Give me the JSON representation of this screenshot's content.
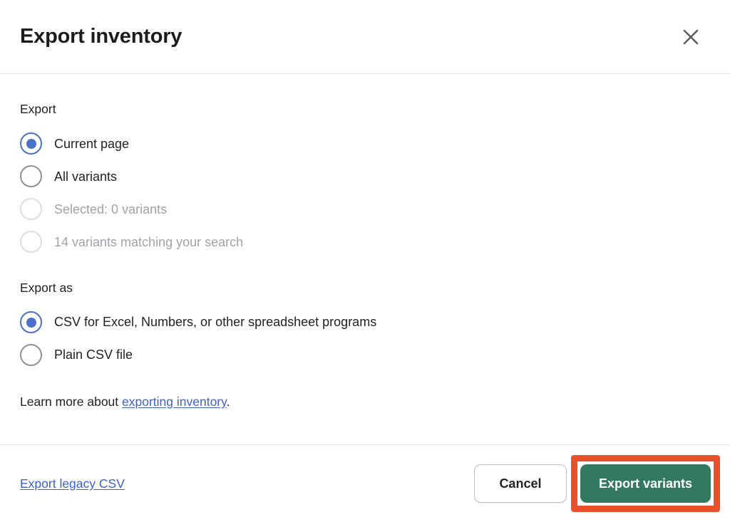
{
  "modal": {
    "title": "Export inventory",
    "close_icon": "close-icon"
  },
  "export_section": {
    "label": "Export",
    "options": [
      {
        "label": "Current page",
        "selected": true,
        "disabled": false
      },
      {
        "label": "All variants",
        "selected": false,
        "disabled": false
      },
      {
        "label": "Selected: 0 variants",
        "selected": false,
        "disabled": true
      },
      {
        "label": "14 variants matching your search",
        "selected": false,
        "disabled": true
      }
    ]
  },
  "export_as_section": {
    "label": "Export as",
    "options": [
      {
        "label": "CSV for Excel, Numbers, or other spreadsheet programs",
        "selected": true,
        "disabled": false
      },
      {
        "label": "Plain CSV file",
        "selected": false,
        "disabled": false
      }
    ]
  },
  "learn_more": {
    "prefix": "Learn more about ",
    "link_text": "exporting inventory",
    "suffix": "."
  },
  "footer": {
    "legacy_link": "Export legacy CSV",
    "cancel_label": "Cancel",
    "primary_label": "Export variants"
  },
  "colors": {
    "radio_selected": "#4b71cc",
    "radio_unselected": "#8c9196",
    "radio_disabled": "#dcdee0",
    "link": "#3c61cc",
    "primary_button_bg": "#33795f",
    "highlight_border": "#e8512c",
    "divider": "#e4e5e7",
    "disabled_text": "#9ea3a8"
  }
}
